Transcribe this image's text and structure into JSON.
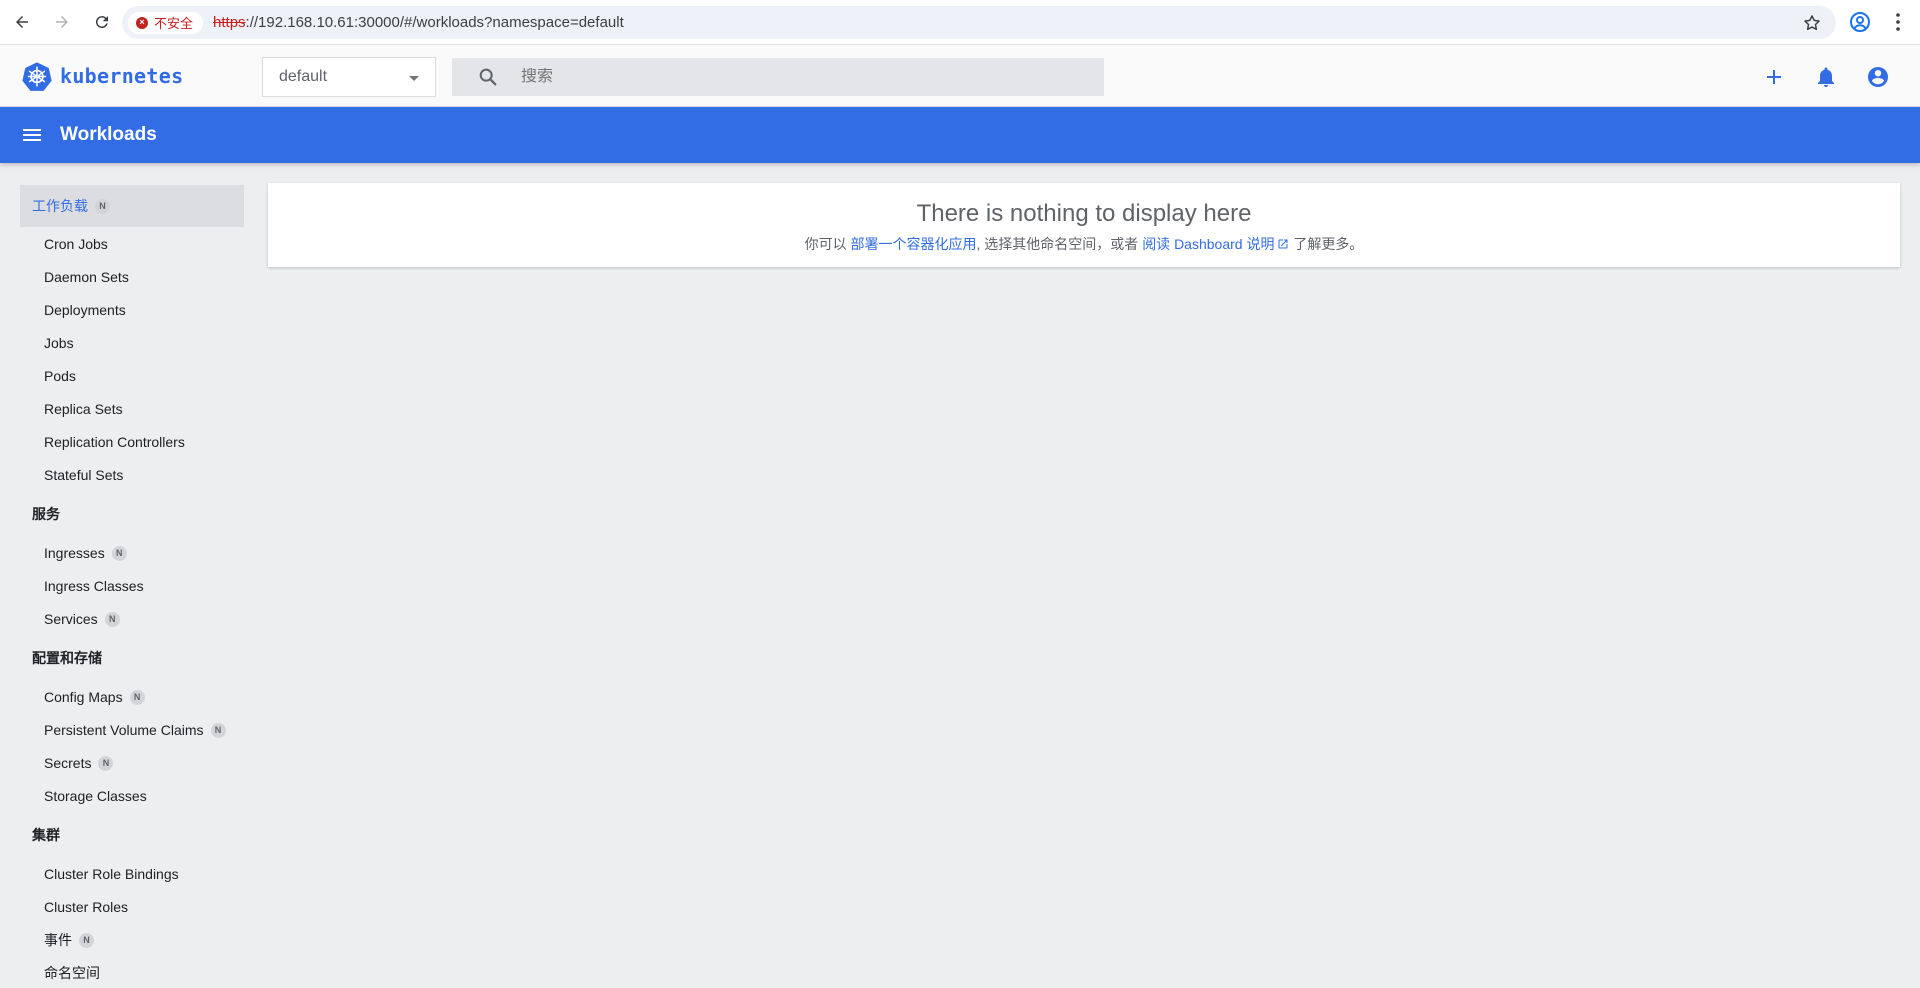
{
  "browser": {
    "security_label": "不安全",
    "url_scheme": "https",
    "url_rest": "://192.168.10.61:30000/#/workloads?namespace=default"
  },
  "header": {
    "logo_text": "kubernetes",
    "namespace": "default",
    "search_placeholder": "搜索"
  },
  "toolbar": {
    "title": "Workloads"
  },
  "sidebar": {
    "groups": [
      {
        "label": "工作负载",
        "badge": "N"
      },
      {
        "label": "服务"
      },
      {
        "label": "配置和存储"
      },
      {
        "label": "集群"
      }
    ],
    "workloads_items": [
      "Cron Jobs",
      "Daemon Sets",
      "Deployments",
      "Jobs",
      "Pods",
      "Replica Sets",
      "Replication Controllers",
      "Stateful Sets"
    ],
    "service_items": [
      {
        "label": "Ingresses",
        "badge": "N"
      },
      {
        "label": "Ingress Classes"
      },
      {
        "label": "Services",
        "badge": "N"
      }
    ],
    "config_items": [
      {
        "label": "Config Maps",
        "badge": "N"
      },
      {
        "label": "Persistent Volume Claims",
        "badge": "N"
      },
      {
        "label": "Secrets",
        "badge": "N"
      },
      {
        "label": "Storage Classes"
      }
    ],
    "cluster_items": [
      {
        "label": "Cluster Role Bindings"
      },
      {
        "label": "Cluster Roles"
      },
      {
        "label": "事件",
        "badge": "N"
      },
      {
        "label": "命名空间"
      }
    ]
  },
  "empty_state": {
    "title": "There is nothing to display here",
    "prefix": "你可以 ",
    "deploy_link": "部署一个容器化应用",
    "middle": ", 选择其他命名空间，或者 ",
    "docs_link": "阅读 Dashboard 说明",
    "suffix": " 了解更多。"
  },
  "colors": {
    "brand_blue": "#326ce5",
    "toolbar_blue": "#326de6",
    "insecure_red": "#c5221f"
  }
}
